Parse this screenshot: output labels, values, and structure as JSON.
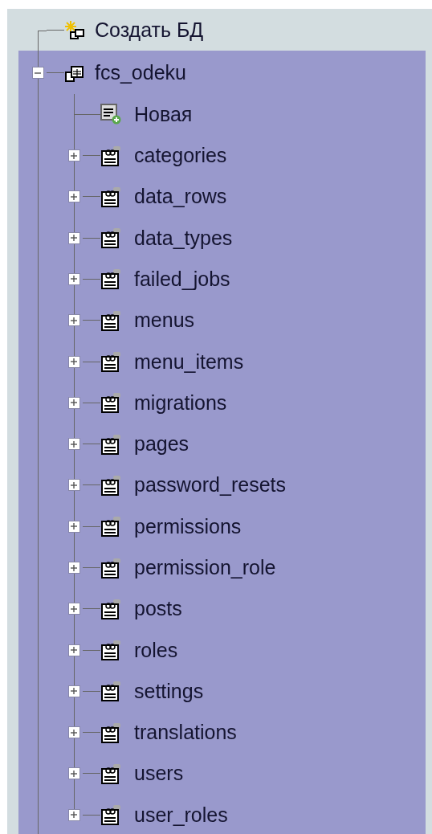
{
  "tree": [
    {
      "label": "Создать БД",
      "kind": "create",
      "selected": false
    },
    {
      "label": "fcs_odeku",
      "kind": "database",
      "selected": true,
      "expanded": true,
      "children": [
        {
          "label": "Новая",
          "kind": "new"
        },
        {
          "label": "categories",
          "kind": "table",
          "expanded": false
        },
        {
          "label": "data_rows",
          "kind": "table",
          "expanded": false
        },
        {
          "label": "data_types",
          "kind": "table",
          "expanded": false
        },
        {
          "label": "failed_jobs",
          "kind": "table",
          "expanded": false
        },
        {
          "label": "menus",
          "kind": "table",
          "expanded": false
        },
        {
          "label": "menu_items",
          "kind": "table",
          "expanded": false
        },
        {
          "label": "migrations",
          "kind": "table",
          "expanded": false
        },
        {
          "label": "pages",
          "kind": "table",
          "expanded": false
        },
        {
          "label": "password_resets",
          "kind": "table",
          "expanded": false
        },
        {
          "label": "permissions",
          "kind": "table",
          "expanded": false
        },
        {
          "label": "permission_role",
          "kind": "table",
          "expanded": false
        },
        {
          "label": "posts",
          "kind": "table",
          "expanded": false
        },
        {
          "label": "roles",
          "kind": "table",
          "expanded": false
        },
        {
          "label": "settings",
          "kind": "table",
          "expanded": false
        },
        {
          "label": "translations",
          "kind": "table",
          "expanded": false
        },
        {
          "label": "users",
          "kind": "table",
          "expanded": false
        },
        {
          "label": "user_roles",
          "kind": "table",
          "expanded": false
        }
      ]
    }
  ]
}
